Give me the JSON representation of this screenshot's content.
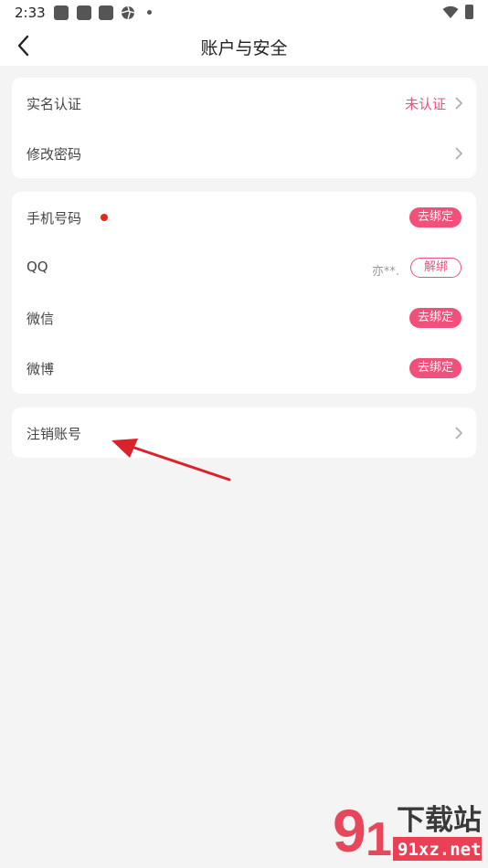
{
  "status_bar": {
    "time": "2:33"
  },
  "nav": {
    "title": "账户与安全"
  },
  "section_identity": {
    "realname_label": "实名认证",
    "realname_status": "未认证",
    "password_label": "修改密码"
  },
  "section_bindings": {
    "phone": {
      "label": "手机号码",
      "action": "去绑定"
    },
    "qq": {
      "label": "QQ",
      "account": "亦**.",
      "action": "解绑"
    },
    "wechat": {
      "label": "微信",
      "action": "去绑定"
    },
    "weibo": {
      "label": "微博",
      "action": "去绑定"
    }
  },
  "section_account": {
    "delete_label": "注销账号"
  },
  "colors": {
    "accent": "#f0507a",
    "notice_dot": "#e8261a",
    "background": "#f4f4f4"
  },
  "watermark": {
    "brand": "下载站",
    "domain": "91xz.net"
  }
}
